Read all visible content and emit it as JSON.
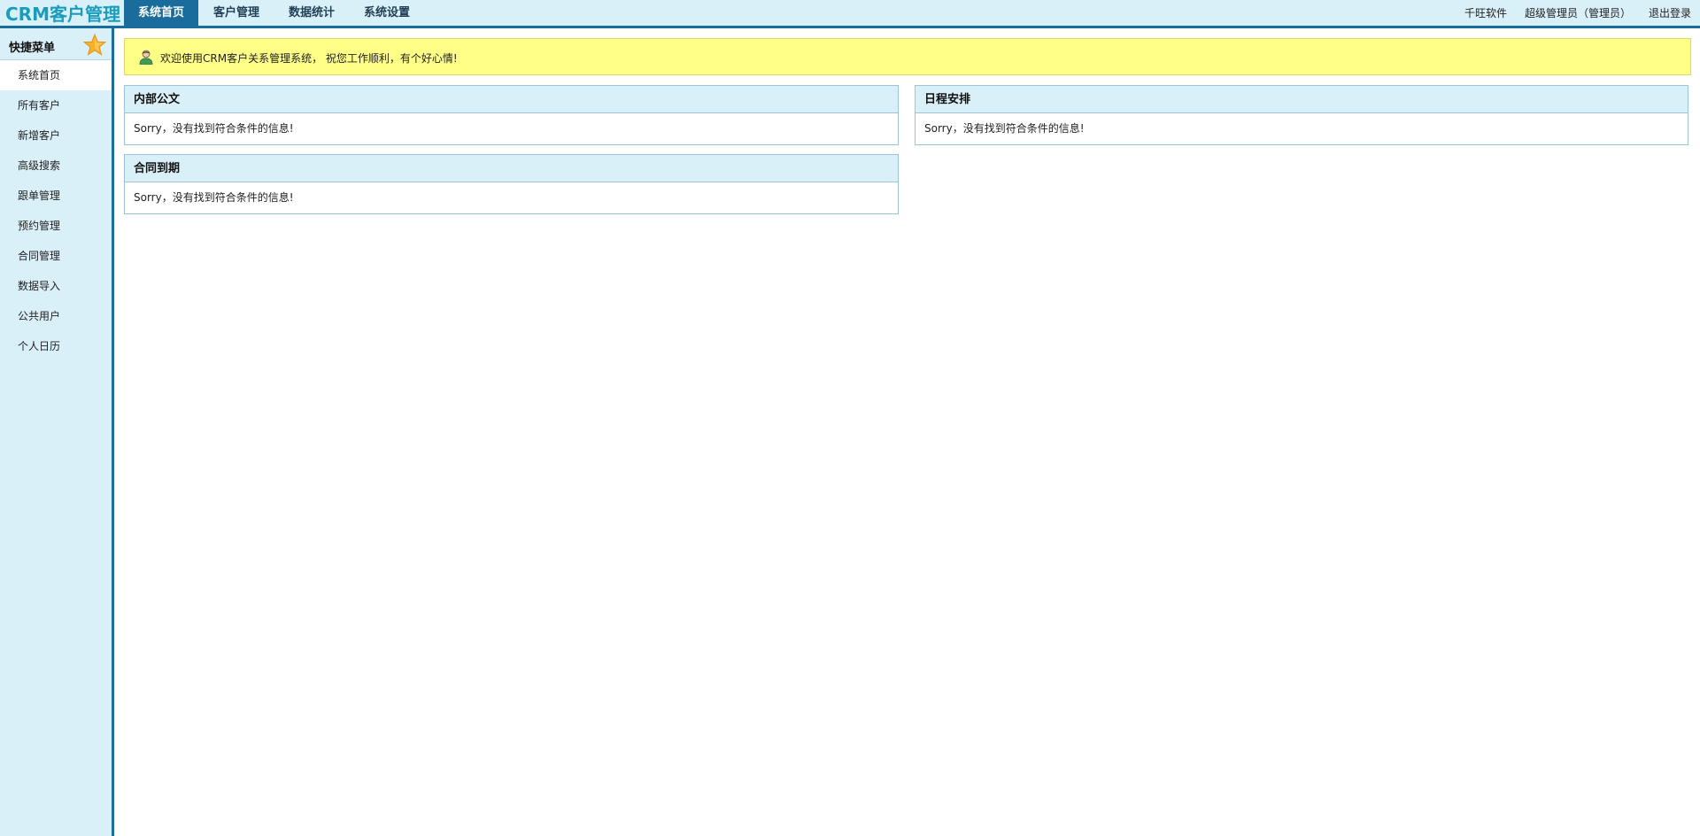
{
  "app": {
    "logo": "CRM客户管理"
  },
  "nav": {
    "items": [
      {
        "label": "系统首页"
      },
      {
        "label": "客户管理"
      },
      {
        "label": "数据统计"
      },
      {
        "label": "系统设置"
      }
    ],
    "active_index": 0
  },
  "top_right": {
    "company": "千旺软件",
    "user": "超级管理员（管理员）",
    "logout": "退出登录"
  },
  "sidebar": {
    "title": "快捷菜单",
    "items": [
      {
        "label": "系统首页"
      },
      {
        "label": "所有客户"
      },
      {
        "label": "新增客户"
      },
      {
        "label": "高级搜索"
      },
      {
        "label": "跟单管理"
      },
      {
        "label": "预约管理"
      },
      {
        "label": "合同管理"
      },
      {
        "label": "数据导入"
      },
      {
        "label": "公共用户"
      },
      {
        "label": "个人日历"
      }
    ],
    "active_index": 0
  },
  "welcome": {
    "text": "欢迎使用CRM客户关系管理系统， 祝您工作顺利，有个好心情!"
  },
  "panels": {
    "docs": {
      "title": "内部公文",
      "message": "Sorry，没有找到符合条件的信息!"
    },
    "schedule": {
      "title": "日程安排",
      "message": "Sorry，没有找到符合条件的信息!"
    },
    "contract": {
      "title": "合同到期",
      "message": "Sorry，没有找到符合条件的信息!"
    }
  },
  "colors": {
    "accent": "#1a6c9c",
    "light_bg": "#daf0f9",
    "logo": "#1a9cbc",
    "notice_bg": "#ffff88"
  },
  "icons": {
    "sidebar_header": "star-icon",
    "welcome": "user-icon"
  }
}
